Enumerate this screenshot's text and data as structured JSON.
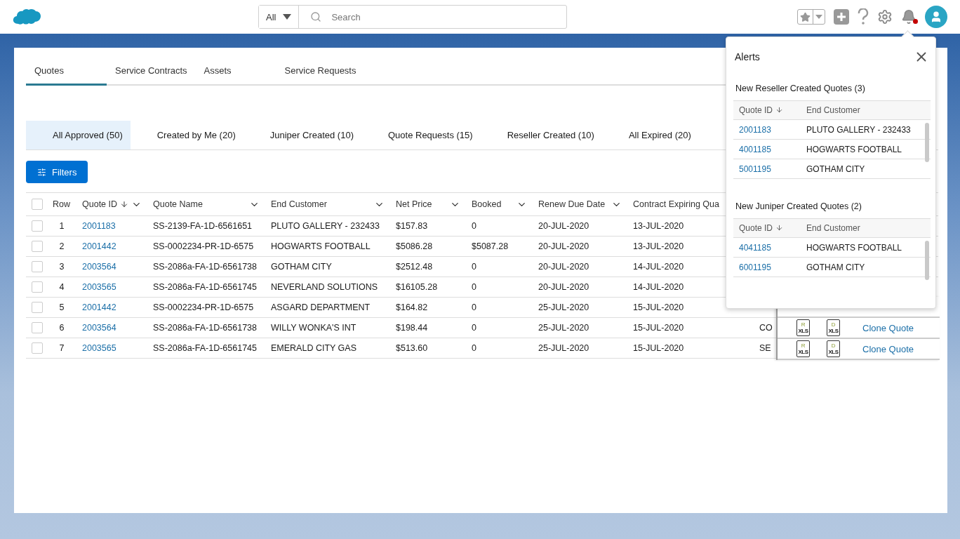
{
  "header": {
    "search_scope": "All",
    "search_placeholder": "Search"
  },
  "tabs": [
    {
      "label": "Quotes",
      "selected": true
    },
    {
      "label": "Service Contracts",
      "selected": false
    },
    {
      "label": "Assets",
      "selected": false
    },
    {
      "label": "Service Requests",
      "selected": false
    }
  ],
  "filters": [
    {
      "label": "All Approved (50)",
      "selected": true
    },
    {
      "label": "Created by Me (20)",
      "selected": false
    },
    {
      "label": "Juniper Created (10)",
      "selected": false
    },
    {
      "label": "Quote Requests (15)",
      "selected": false
    },
    {
      "label": "Reseller Created (10)",
      "selected": false
    },
    {
      "label": "All Expired (20)",
      "selected": false
    }
  ],
  "filter_button": "Filters",
  "table": {
    "all_checked": false,
    "columns": [
      {
        "label": "Row"
      },
      {
        "label": "Quote ID",
        "sorted": true,
        "menu": true
      },
      {
        "label": "Quote Name",
        "sorted": false,
        "menu": true
      },
      {
        "label": "End Customer",
        "sorted": false,
        "menu": true
      },
      {
        "label": "Net Price",
        "sorted": false,
        "menu": true
      },
      {
        "label": "Booked",
        "sorted": false,
        "menu": true
      },
      {
        "label": "Renew Due Date",
        "sorted": false,
        "menu": true
      },
      {
        "label": "Contract Expiring Qua",
        "sorted": false
      }
    ],
    "rows": [
      {
        "checked": false,
        "cells": [
          "1",
          "2001183",
          "SS-2139-FA-1D-6561651",
          "PLUTO GALLERY - 232433",
          "$157.83",
          "0",
          "20-JUL-2020",
          "13-JUL-2020"
        ]
      },
      {
        "checked": false,
        "cells": [
          "2",
          "2001442",
          "SS-0002234-PR-1D-6575",
          "HOGWARTS FOOTBALL",
          "$5086.28",
          "$5087.28",
          "20-JUL-2020",
          "13-JUL-2020"
        ]
      },
      {
        "checked": false,
        "cells": [
          "3",
          "2003564",
          "SS-2086a-FA-1D-6561738",
          "GOTHAM CITY",
          "$2512.48",
          "0",
          "20-JUL-2020",
          "14-JUL-2020"
        ]
      },
      {
        "checked": false,
        "cells": [
          "4",
          "2003565",
          "SS-2086a-FA-1D-6561745",
          "NEVERLAND SOLUTIONS",
          "$16105.28",
          "0",
          "20-JUL-2020",
          "14-JUL-2020"
        ]
      },
      {
        "checked": false,
        "cells": [
          "5",
          "2001442",
          "SS-0002234-PR-1D-6575",
          "ASGARD DEPARTMENT",
          "$164.82",
          "0",
          "25-JUL-2020",
          "15-JUL-2020"
        ]
      },
      {
        "checked": false,
        "cells": [
          "6",
          "2003564",
          "SS-2086a-FA-1D-6561738",
          "WILLY WONKA'S INT",
          "$198.44",
          "0",
          "25-JUL-2020",
          "15-JUL-2020"
        ],
        "column_9": "CO"
      },
      {
        "checked": false,
        "cells": [
          "7",
          "2003565",
          "SS-2086a-FA-1D-6561745",
          "EMERALD CITY GAS",
          "$513.60",
          "0",
          "25-JUL-2020",
          "15-JUL-2020"
        ],
        "column_9": "SE"
      }
    ]
  },
  "pinned_actions": [
    {
      "files": [
        {
          "letter": "R",
          "type": "XLS"
        },
        {
          "letter": "D",
          "type": "XLS"
        }
      ],
      "action": "Clone Quote"
    },
    {
      "files": [
        {
          "letter": "R",
          "type": "XLS"
        },
        {
          "letter": "D",
          "type": "XLS"
        }
      ],
      "action": "Clone Quote"
    }
  ],
  "alerts": {
    "title": "Alerts",
    "sections": [
      {
        "title": "New Reseller Created Quotes (3)",
        "columns": [
          "Quote ID",
          "End Customer"
        ],
        "rows": [
          [
            "2001183",
            "PLUTO GALLERY - 232433"
          ],
          [
            "4001185",
            "HOGWARTS FOOTBALL"
          ],
          [
            "5001195",
            "GOTHAM CITY"
          ]
        ]
      },
      {
        "title": "New Juniper Created Quotes (2)",
        "columns": [
          "Quote ID",
          "End Customer"
        ],
        "rows": [
          [
            "4041185",
            "HOGWARTS FOOTBALL"
          ],
          [
            "6001195",
            "GOTHAM CITY"
          ]
        ]
      }
    ]
  }
}
